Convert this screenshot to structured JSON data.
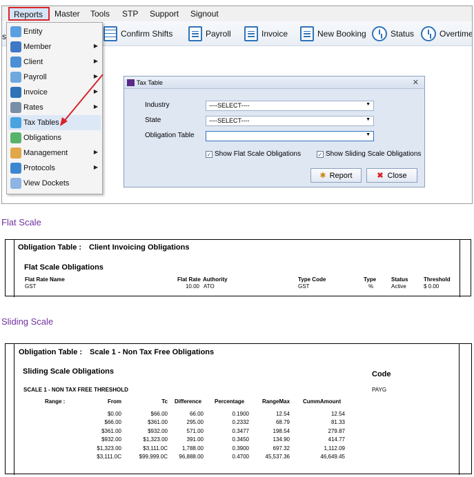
{
  "menubar": {
    "items": [
      "Reports",
      "Master",
      "Tools",
      "STP",
      "Support",
      "Signout"
    ]
  },
  "toolbar": {
    "partial_left": "s",
    "buttons": [
      "Confirm Shifts",
      "Payroll",
      "Invoice",
      "New Booking",
      "Status",
      "Overtime"
    ]
  },
  "dropdown": {
    "items": [
      {
        "label": "Entity",
        "submenu": false
      },
      {
        "label": "Member",
        "submenu": true
      },
      {
        "label": "Client",
        "submenu": true
      },
      {
        "label": "Payroll",
        "submenu": true
      },
      {
        "label": "Invoice",
        "submenu": true
      },
      {
        "label": "Rates",
        "submenu": true
      },
      {
        "label": "Tax Tables",
        "submenu": false
      },
      {
        "label": "Obligations",
        "submenu": false
      },
      {
        "label": "Management",
        "submenu": true
      },
      {
        "label": "Protocols",
        "submenu": true
      },
      {
        "label": "View Dockets",
        "submenu": false
      }
    ]
  },
  "dialog": {
    "title": "Tax Table",
    "industry_label": "Industry",
    "industry_value": "----SELECT----",
    "state_label": "State",
    "state_value": "----SELECT----",
    "obligation_label": "Obligation Table",
    "obligation_value": "",
    "flat_check_label": "Show Flat Scale Obligations",
    "sliding_check_label": "Show Sliding Scale Obligations",
    "report_button": "Report",
    "close_button": "Close"
  },
  "flat_section": {
    "heading": "Flat Scale",
    "obligation_table_label": "Obligation Table :",
    "obligation_table_value": "Client Invoicing Obligations",
    "subheading": "Flat Scale Obligations",
    "headers": {
      "name": "Flat Rate Name",
      "rate": "Flat Rate",
      "authority": "Authority",
      "type_code": "Type Code",
      "type": "Type",
      "status": "Status",
      "threshold": "Threshold"
    },
    "row": {
      "name": "GST",
      "rate": "10.00",
      "authority": "ATO",
      "type_code": "GST",
      "type": "%",
      "status": "Active",
      "threshold": "$ 0.00"
    }
  },
  "sliding_section": {
    "heading": "Sliding Scale",
    "obligation_table_label": "Obligation Table :",
    "obligation_table_value": "Scale 1 - Non Tax Free Obligations",
    "subheading": "Sliding Scale Obligations",
    "code_label": "Code",
    "code_value": "PAYG",
    "threshold_title": "SCALE 1 - NON TAX FREE THRESHOLD",
    "headers": {
      "range": "Range :",
      "from": "From",
      "to": "Tc",
      "difference": "Difference",
      "percentage": "Percentage",
      "rangemax": "RangeMax",
      "cumm": "CummAmount"
    },
    "rows": [
      {
        "from": "$0.00",
        "to": "$66.00",
        "difference": "66.00",
        "percentage": "0.1900",
        "rangemax": "12.54",
        "cumm": "12.54"
      },
      {
        "from": "$66.00",
        "to": "$361.00",
        "difference": "295.00",
        "percentage": "0.2332",
        "rangemax": "68.79",
        "cumm": "81.33"
      },
      {
        "from": "$361.00",
        "to": "$932.00",
        "difference": "571.00",
        "percentage": "0.3477",
        "rangemax": "198.54",
        "cumm": "279.87"
      },
      {
        "from": "$932.00",
        "to": "$1,323.00",
        "difference": "391.00",
        "percentage": "0.3450",
        "rangemax": "134.90",
        "cumm": "414.77"
      },
      {
        "from": "$1,323.00",
        "to": "$3,111.0C",
        "difference": "1,788.00",
        "percentage": "0.3900",
        "rangemax": "697.32",
        "cumm": "1,112.09"
      },
      {
        "from": "$3,111.0C",
        "to": "$99,999.0C",
        "difference": "96,888.00",
        "percentage": "0.4700",
        "rangemax": "45,537.36",
        "cumm": "46,649.45"
      }
    ]
  },
  "colors": {
    "highlight_border": "#d7242b",
    "section_heading": "#7030a0",
    "icon_blue": "#2e72b8",
    "dialog_bg": "#dfe7f3"
  }
}
